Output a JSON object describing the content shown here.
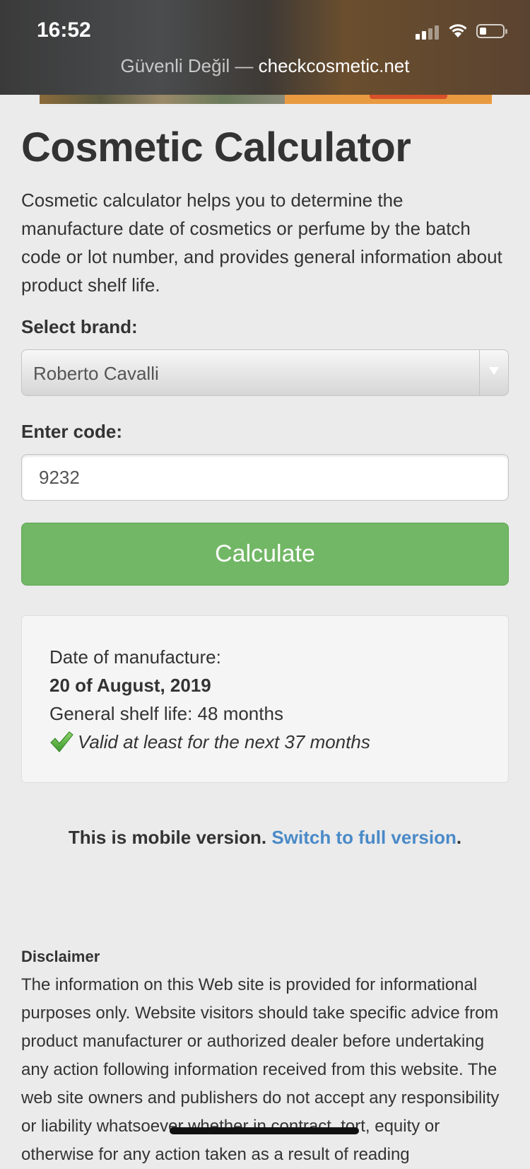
{
  "status_bar": {
    "time": "16:52",
    "url_security": "Güvenli Değil",
    "url_separator": "—",
    "url_host": "checkcosmetic.net"
  },
  "page": {
    "title": "Cosmetic Calculator",
    "intro": "Cosmetic calculator helps you to determine the manufacture date of cosmetics or perfume by the batch code or lot number, and provides general information about product shelf life."
  },
  "form": {
    "brand_label": "Select brand:",
    "brand_value": "Roberto Cavalli",
    "code_label": "Enter code:",
    "code_value": "9232",
    "calculate_label": "Calculate"
  },
  "result": {
    "manufacture_label": "Date of manufacture:",
    "manufacture_date": "20 of August, 2019",
    "shelf_life": "General shelf life: 48 months",
    "validity": "Valid at least for the next 37 months"
  },
  "mobile_note": {
    "text": "This is mobile version.",
    "link": "Switch to full version",
    "suffix": "."
  },
  "disclaimer": {
    "title": "Disclaimer",
    "body": "The information on this Web site is provided for informational purposes only. Website visitors should take specific advice from product manufacturer or authorized dealer before undertaking any action following information received from this website. The web site owners and publishers do not accept any responsibility or liability whatsoever whether in contract, tort, equity or otherwise for any action taken as a result of reading"
  },
  "colors": {
    "button_green": "#72b766",
    "link_blue": "#4a8ac8",
    "page_bg": "#ebebeb"
  }
}
